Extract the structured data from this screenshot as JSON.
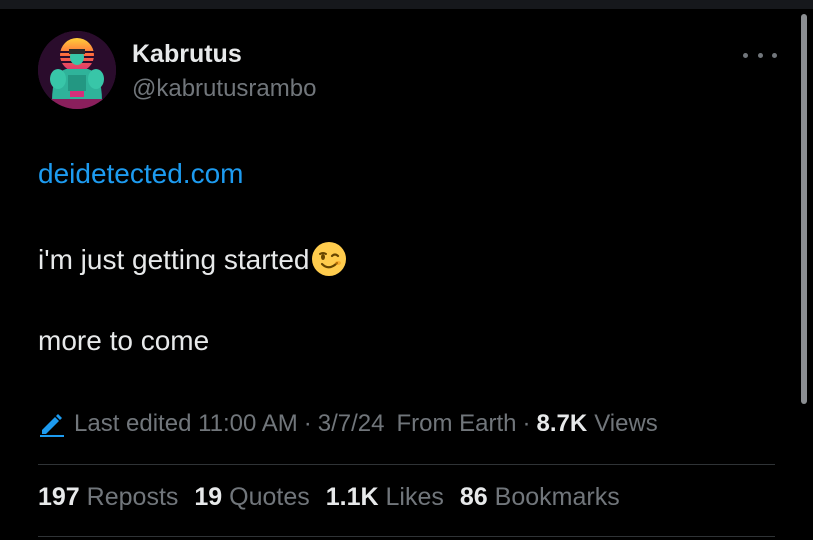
{
  "author": {
    "name": "Kabrutus",
    "handle": "@kabrutusrambo"
  },
  "tweet": {
    "link_text": "deidetected.com",
    "line1": "i'm just getting started",
    "line2": "more to come",
    "emoji_icon": "winking-face-icon"
  },
  "meta": {
    "edited_label": "Last edited 11:00 AM",
    "separator": "·",
    "date": "3/7/24",
    "location": "From Earth",
    "views_count": "8.7K",
    "views_label": "Views"
  },
  "stats": [
    {
      "count": "197",
      "label": "Reposts"
    },
    {
      "count": "19",
      "label": "Quotes"
    },
    {
      "count": "1.1K",
      "label": "Likes"
    },
    {
      "count": "86",
      "label": "Bookmarks"
    }
  ],
  "colors": {
    "link": "#1d9bf0",
    "secondary_text": "#71767b",
    "primary_text": "#e7e9ea",
    "background": "#000000"
  }
}
